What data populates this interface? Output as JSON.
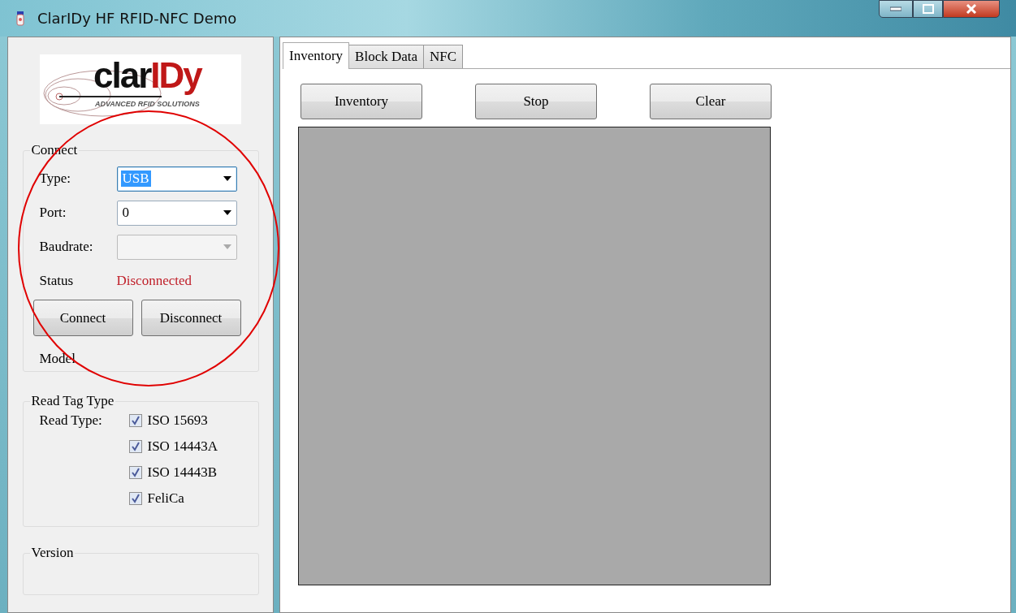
{
  "window": {
    "title": "ClarIDy HF RFID-NFC Demo"
  },
  "logo": {
    "brand_plain": "clar",
    "brand_accent": "IDy",
    "tagline": "ADVANCED RFID SOLUTIONS"
  },
  "connect": {
    "title": "Connect",
    "fields": [
      {
        "label": "Type:",
        "value": "USB",
        "highlighted": true,
        "disabled": false
      },
      {
        "label": "Port:",
        "value": "0",
        "highlighted": false,
        "disabled": false
      },
      {
        "label": "Baudrate:",
        "highlighted": false,
        "disabled": true
      }
    ],
    "status_label": "Status",
    "status": "Disconnected",
    "buttons": [
      "Connect",
      "Disconnect"
    ],
    "model_label": "Model"
  },
  "read_tag_type": {
    "title": "Read Tag Type",
    "label": "Read Type:",
    "options": [
      {
        "label": "ISO 15693",
        "checked": true
      },
      {
        "label": "ISO 14443A",
        "checked": true
      },
      {
        "label": "ISO 14443B",
        "checked": true
      },
      {
        "label": "FeliCa",
        "checked": true
      }
    ]
  },
  "version": {
    "title": "Version"
  },
  "tabs": [
    {
      "label": "Inventory",
      "selected": true
    },
    {
      "label": "Block Data",
      "selected": false
    },
    {
      "label": "NFC",
      "selected": false
    }
  ],
  "toolbar": [
    "Inventory",
    "Stop",
    "Clear"
  ],
  "annotation": {
    "kind": "circle"
  }
}
